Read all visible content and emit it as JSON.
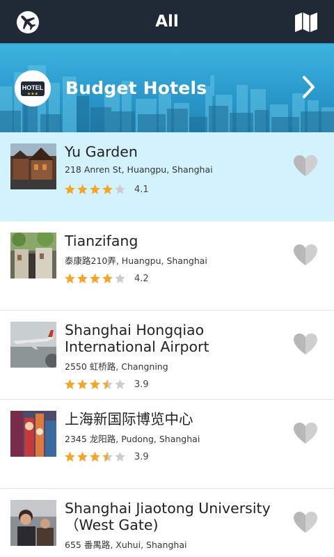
{
  "topbar": {
    "title": "All",
    "left_icon": "airplane-icon",
    "right_icon": "map-icon"
  },
  "banner": {
    "title": "Budget Hotels",
    "badge_text": "HOTEL",
    "badge_icon": "hotel-badge-icon",
    "chevron_icon": "chevron-right-icon"
  },
  "colors": {
    "topbar": "#1f2a36",
    "banner": "#2a9acb",
    "selected_row": "#d3f3fc",
    "star_filled": "#f5a623",
    "star_empty": "#cccccc",
    "heart": "#b8b8b8"
  },
  "places": [
    {
      "name": "Yu Garden",
      "address": "218 Anren St, Huangpu, Shanghai",
      "rating": 4.1,
      "rating_text": "4.1",
      "stars": [
        1,
        1,
        1,
        1,
        0
      ],
      "selected": true
    },
    {
      "name": "Tianzifang",
      "address": "泰康路210弄, Huangpu, Shanghai",
      "rating": 4.2,
      "rating_text": "4.2",
      "stars": [
        1,
        1,
        1,
        1,
        0
      ],
      "selected": false
    },
    {
      "name": "Shanghai Hongqiao International Airport",
      "address": "2550 虹桥路, Changning",
      "rating": 3.9,
      "rating_text": "3.9",
      "stars": [
        1,
        1,
        1,
        0.5,
        0
      ],
      "selected": false
    },
    {
      "name": "上海新国际博览中心",
      "address": "2345 龙阳路, Pudong, Shanghai",
      "rating": 3.9,
      "rating_text": "3.9",
      "stars": [
        1,
        1,
        1,
        0.5,
        0
      ],
      "selected": false
    },
    {
      "name": "Shanghai Jiaotong University （West Gate)",
      "address": "655 番禺路, Xuhui, Shanghai",
      "rating": null,
      "rating_text": "",
      "stars": [],
      "selected": false
    }
  ]
}
